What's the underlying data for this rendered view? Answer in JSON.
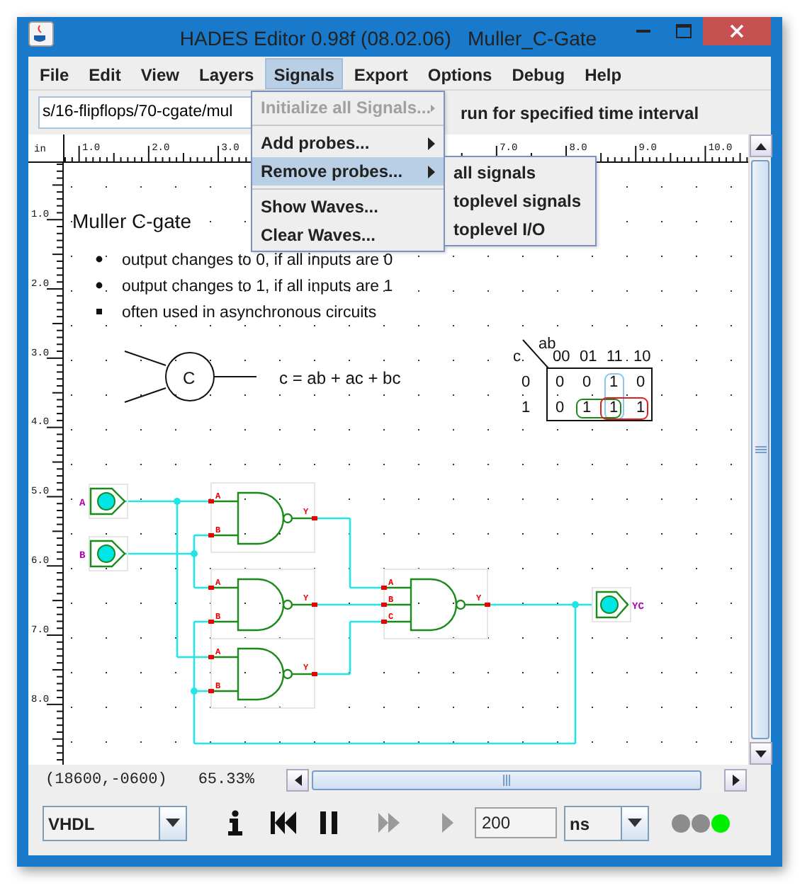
{
  "window": {
    "title": "HADES Editor 0.98f (08.02.06)   Muller_C-Gate"
  },
  "menu_bar": [
    {
      "label": "File",
      "selected": false
    },
    {
      "label": "Edit",
      "selected": false
    },
    {
      "label": "View",
      "selected": false
    },
    {
      "label": "Layers",
      "selected": false
    },
    {
      "label": "Signals",
      "selected": true
    },
    {
      "label": "Export",
      "selected": false
    },
    {
      "label": "Options",
      "selected": false
    },
    {
      "label": "Debug",
      "selected": false
    },
    {
      "label": "Help",
      "selected": false
    }
  ],
  "signals_menu": [
    {
      "kind": "item",
      "label": "Initialize all Signals...",
      "disabled": true,
      "submenu": true,
      "selected": false
    },
    {
      "kind": "separator"
    },
    {
      "kind": "item",
      "label": "Add probes...",
      "disabled": false,
      "submenu": true,
      "selected": false
    },
    {
      "kind": "item",
      "label": "Remove probes...",
      "disabled": false,
      "submenu": true,
      "selected": true
    },
    {
      "kind": "separator"
    },
    {
      "kind": "item",
      "label": "Show Waves...",
      "disabled": false,
      "submenu": false,
      "selected": false
    },
    {
      "kind": "item",
      "label": "Clear Waves...",
      "disabled": false,
      "submenu": false,
      "selected": false
    }
  ],
  "remove_probes_menu": [
    {
      "label": "all signals"
    },
    {
      "label": "toplevel signals"
    },
    {
      "label": "toplevel I/O"
    }
  ],
  "toolbar": {
    "path": "s/16-flipflops/70-cgate/mul",
    "hint": "run for specified time interval"
  },
  "ruler": {
    "unit": "in",
    "top_labels": [
      "1.0",
      "2.0",
      "3.0",
      "7.0",
      "8.0",
      "9.0",
      "10.0"
    ],
    "left_labels": [
      "1.0",
      "2.0",
      "3.0",
      "4.0",
      "5.0",
      "6.0",
      "7.0",
      "8.0"
    ]
  },
  "canvas": {
    "title": "Muller C-gate",
    "bullets": [
      {
        "kind": "dot",
        "text": "output changes to 0, if all inputs are 0"
      },
      {
        "kind": "dot",
        "text": "output changes to 1, if all inputs are 1"
      },
      {
        "kind": "square",
        "text": "often used in asynchronous circuits"
      }
    ],
    "symbol_label": "C",
    "equation": "c = ab + ac + bc",
    "kmap": {
      "col_var": "ab",
      "row_var": "c",
      "columns": [
        "00",
        "01",
        "11",
        "10"
      ],
      "rows": [
        {
          "label": "0",
          "cells": [
            "0",
            "0",
            "1",
            "0"
          ]
        },
        {
          "label": "1",
          "cells": [
            "0",
            "1",
            "1",
            "1"
          ]
        }
      ]
    },
    "inputs": [
      {
        "label": "A"
      },
      {
        "label": "B"
      }
    ],
    "gates": [
      {
        "inputs": [
          "A",
          "B"
        ],
        "output": "Y"
      },
      {
        "inputs": [
          "A",
          "B"
        ],
        "output": "Y"
      },
      {
        "inputs": [
          "A",
          "B"
        ],
        "output": "Y"
      },
      {
        "inputs": [
          "A",
          "B",
          "C"
        ],
        "output": "Y"
      }
    ],
    "output": {
      "label": "YC"
    }
  },
  "status": {
    "coords": "(18600,-0600)",
    "zoom": "65.33%"
  },
  "controls": {
    "language": "VHDL",
    "interval": "200",
    "unit": "ns",
    "buttons": [
      {
        "kind": "info",
        "disabled": false
      },
      {
        "kind": "rewind",
        "disabled": false
      },
      {
        "kind": "pause",
        "disabled": false
      },
      {
        "kind": "fast_forward",
        "disabled": true
      },
      {
        "kind": "play",
        "disabled": true
      }
    ],
    "lights": [
      {
        "color": "#8c8c8c"
      },
      {
        "color": "#8c8c8c"
      },
      {
        "color": "#00ee00"
      }
    ]
  }
}
